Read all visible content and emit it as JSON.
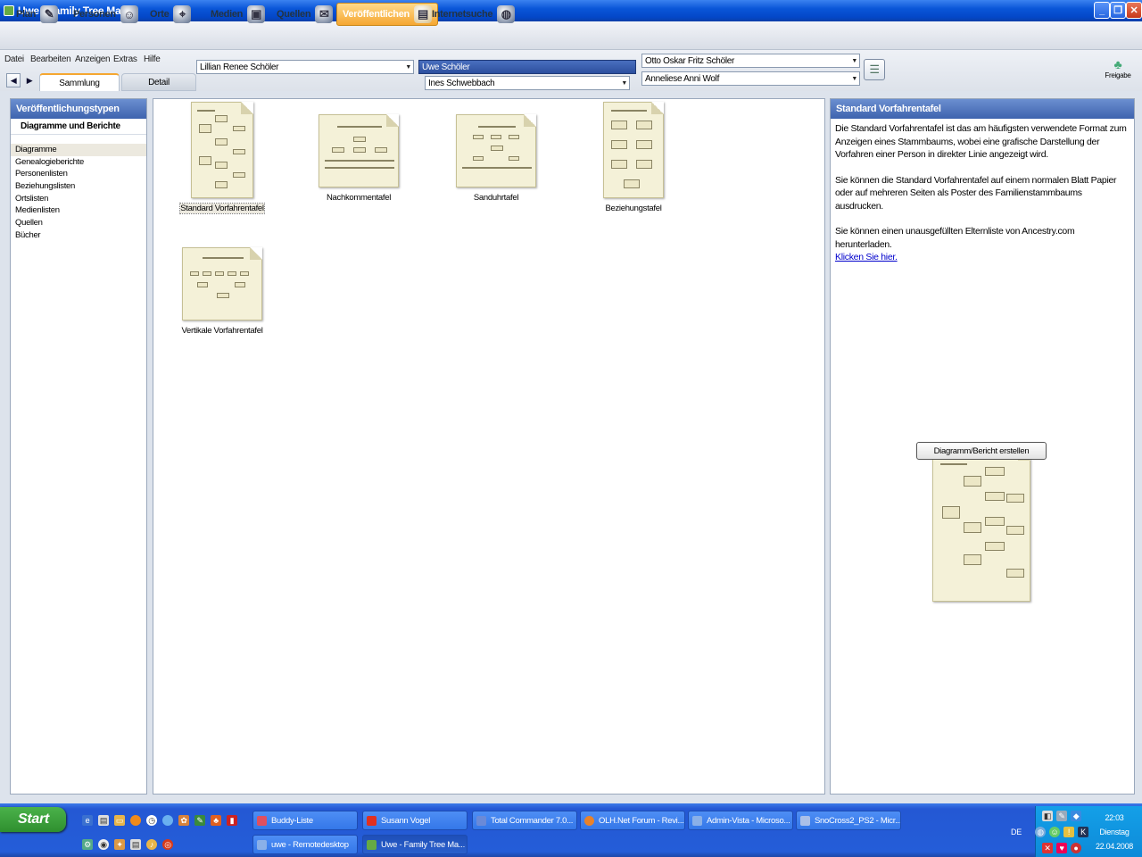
{
  "window": {
    "title": "Uwe - Family Tree Maker",
    "minimize": "_",
    "maximize": "❐",
    "close": "✕"
  },
  "toolbar": {
    "items": [
      {
        "label": "Plan",
        "icon": "plan-icon"
      },
      {
        "label": "Personen",
        "icon": "people-icon"
      },
      {
        "label": "Orte",
        "icon": "places-icon"
      },
      {
        "label": "Medien",
        "icon": "media-icon"
      },
      {
        "label": "Quellen",
        "icon": "sources-icon"
      },
      {
        "label": "Veröffentlichen",
        "icon": "publish-icon",
        "active": true
      },
      {
        "label": "Internetsuche",
        "icon": "globe-icon"
      }
    ]
  },
  "menu": {
    "items": [
      "Datei",
      "Bearbeiten",
      "Anzeigen",
      "Extras",
      "Hilfe"
    ]
  },
  "tabs": {
    "sammlung": "Sammlung",
    "detail": "Detail"
  },
  "family": {
    "person_left": "Lillian Renee Schöler",
    "person_selected": "Uwe Schöler",
    "spouse": "Ines Schwebbach",
    "father": "Otto Oskar Fritz Schöler",
    "mother": "Anneliese Anni Wolf",
    "share_label": "Freigabe"
  },
  "left_panel": {
    "title": "Veröffentlichungstypen",
    "subtitle": "Diagramme und Berichte",
    "items": [
      "Diagramme",
      "Genealogieberichte",
      "Personenlisten",
      "Beziehungslisten",
      "Ortslisten",
      "Medienlisten",
      "Quellen",
      "Bücher"
    ],
    "selected": "Diagramme"
  },
  "charts": [
    {
      "label": "Standard Vorfahrentafel",
      "selected": true
    },
    {
      "label": "Nachkommentafel"
    },
    {
      "label": "Sanduhrtafel"
    },
    {
      "label": "Beziehungstafel"
    },
    {
      "label": "Vertikale Vorfahrentafel"
    }
  ],
  "right_panel": {
    "title": "Standard Vorfahrentafel",
    "para1": "Die Standard Vorfahrentafel ist das am häufigsten verwendete Format zum Anzeigen eines Stammbaums, wobei eine grafische Darstellung der Vorfahren einer Person in direkter Linie angezeigt wird.",
    "para2": "Sie können die Standard Vorfahrentafel auf einem normalen Blatt Papier oder auf mehreren Seiten als Poster des Familienstammbaums ausdrucken.",
    "para3": "Sie können einen unausgefüllten Elternliste von Ancestry.com herunterladen.",
    "link": "Klicken Sie hier.",
    "button": "Diagramm/Bericht erstellen"
  },
  "taskbar": {
    "start": "Start",
    "tasks_row1": [
      "Buddy-Liste",
      "Susann Vogel",
      "Total Commander 7.0...",
      "OLH.Net Forum - Revi...",
      "Admin-Vista - Microso...",
      "SnoCross2_PS2 - Micr..."
    ],
    "tasks_row2": [
      "uwe - Remotedesktop",
      "Uwe - Family Tree Ma..."
    ],
    "language": "DE",
    "time": "22:03",
    "weekday": "Dienstag",
    "date": "22.04.2008"
  },
  "colors": {
    "accent": "#f5a731",
    "panel_header": "#3e63ae",
    "link": "#0000cc"
  }
}
